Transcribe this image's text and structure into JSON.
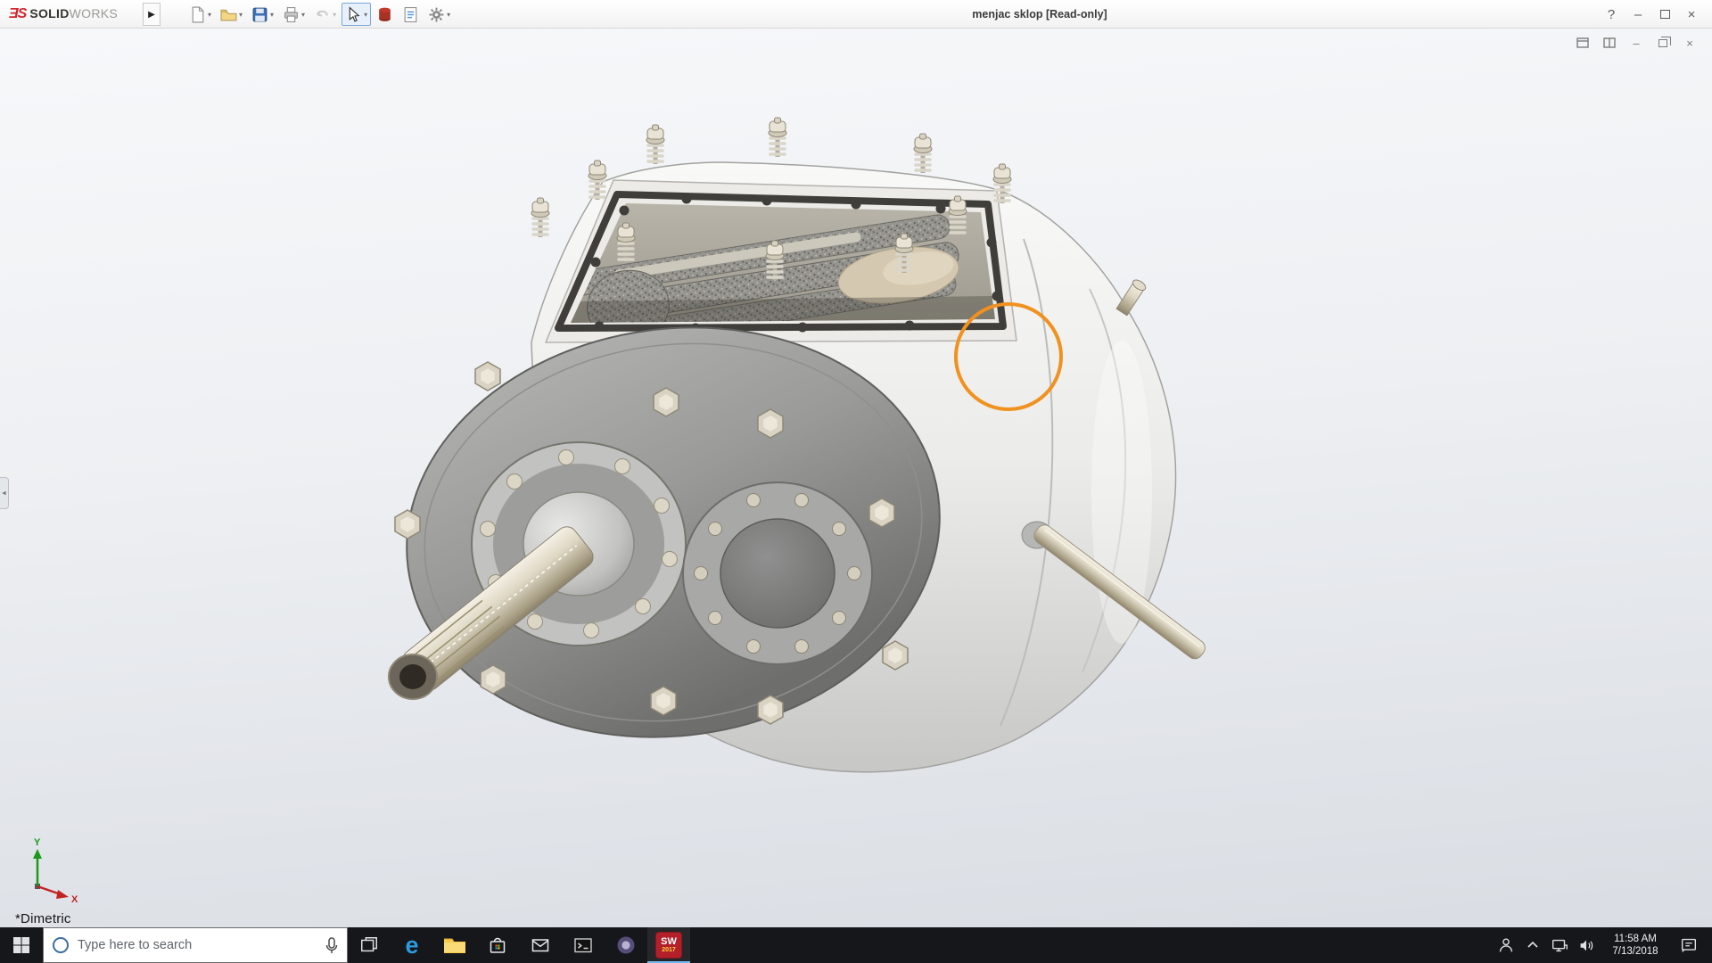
{
  "titlebar": {
    "brand": {
      "logo_glyph": "ƎS",
      "name_primary": "SOLID",
      "name_secondary": "WORKS"
    },
    "flyout_arrow": "▶",
    "title": "menjac sklop [Read-only]",
    "window_buttons": {
      "help": "?",
      "minimize": "–",
      "close": "×"
    }
  },
  "toolbar": {
    "dropdown_glyph": "▾",
    "items": [
      {
        "name": "new-document",
        "dropdown": true
      },
      {
        "name": "open",
        "dropdown": true
      },
      {
        "name": "save",
        "dropdown": true
      },
      {
        "name": "print",
        "dropdown": true
      },
      {
        "name": "undo",
        "dropdown": true,
        "disabled": true
      },
      {
        "name": "select",
        "dropdown": true,
        "active": true
      },
      {
        "name": "rebuild",
        "dropdown": false
      },
      {
        "name": "file-properties",
        "dropdown": false
      },
      {
        "name": "options",
        "dropdown": true
      }
    ]
  },
  "document_controls": {
    "minimize": "–",
    "close": "×"
  },
  "viewport": {
    "view_orientation_label": "*Dimetric",
    "annotation_circle_color": "#f09120",
    "triad": {
      "x_label": "X",
      "y_label": "Y",
      "x_color": "#c22222",
      "y_color": "#1a991a"
    }
  },
  "taskbar": {
    "search": {
      "placeholder": "Type here to search"
    },
    "pinned_items": [
      "start",
      "search",
      "task-view",
      "edge",
      "file-explorer",
      "store",
      "mail",
      "console",
      "pinned-app",
      "solidworks-2017"
    ],
    "edge_glyph": "e",
    "solidworks_badge": {
      "letters": "SW",
      "year": "2017"
    },
    "tray": {
      "time": "11:58 AM",
      "date": "7/13/2018"
    }
  }
}
